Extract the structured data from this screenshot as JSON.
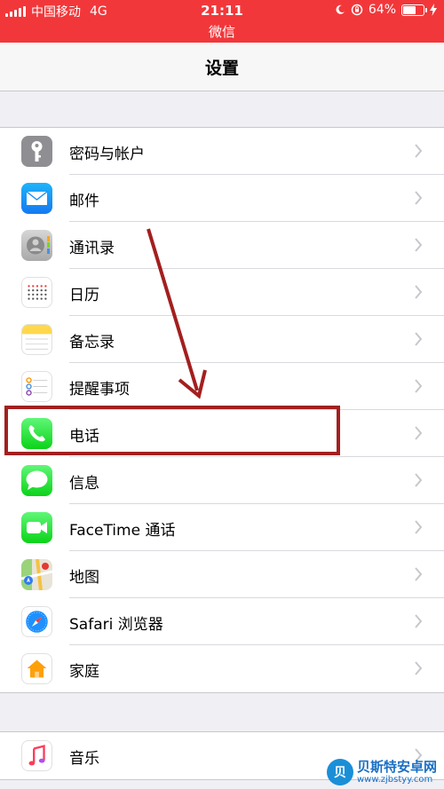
{
  "status_bar": {
    "carrier": "中国移动",
    "network": "4G",
    "time": "21:11",
    "subtitle": "微信",
    "battery": "64%",
    "battery_level": 0.64,
    "background_color": "#f2373a"
  },
  "nav": {
    "title": "设置"
  },
  "settings_group": {
    "items": [
      {
        "label": "密码与帐户",
        "icon": "key-icon"
      },
      {
        "label": "邮件",
        "icon": "mail-icon"
      },
      {
        "label": "通讯录",
        "icon": "contacts-icon"
      },
      {
        "label": "日历",
        "icon": "calendar-icon"
      },
      {
        "label": "备忘录",
        "icon": "notes-icon"
      },
      {
        "label": "提醒事项",
        "icon": "reminders-icon"
      },
      {
        "label": "电话",
        "icon": "phone-icon"
      },
      {
        "label": "信息",
        "icon": "messages-icon"
      },
      {
        "label": "FaceTime 通话",
        "icon": "facetime-icon"
      },
      {
        "label": "地图",
        "icon": "maps-icon"
      },
      {
        "label": "Safari 浏览器",
        "icon": "safari-icon"
      },
      {
        "label": "家庭",
        "icon": "home-icon"
      }
    ]
  },
  "media_group": {
    "items": [
      {
        "label": "音乐",
        "icon": "music-icon"
      }
    ]
  },
  "annotation": {
    "highlight_color": "#a31f1f",
    "highlighted_item": "电话"
  },
  "watermark": {
    "logo": "贝",
    "title": "贝斯特安卓网",
    "url": "www.zjbstyy.com"
  }
}
